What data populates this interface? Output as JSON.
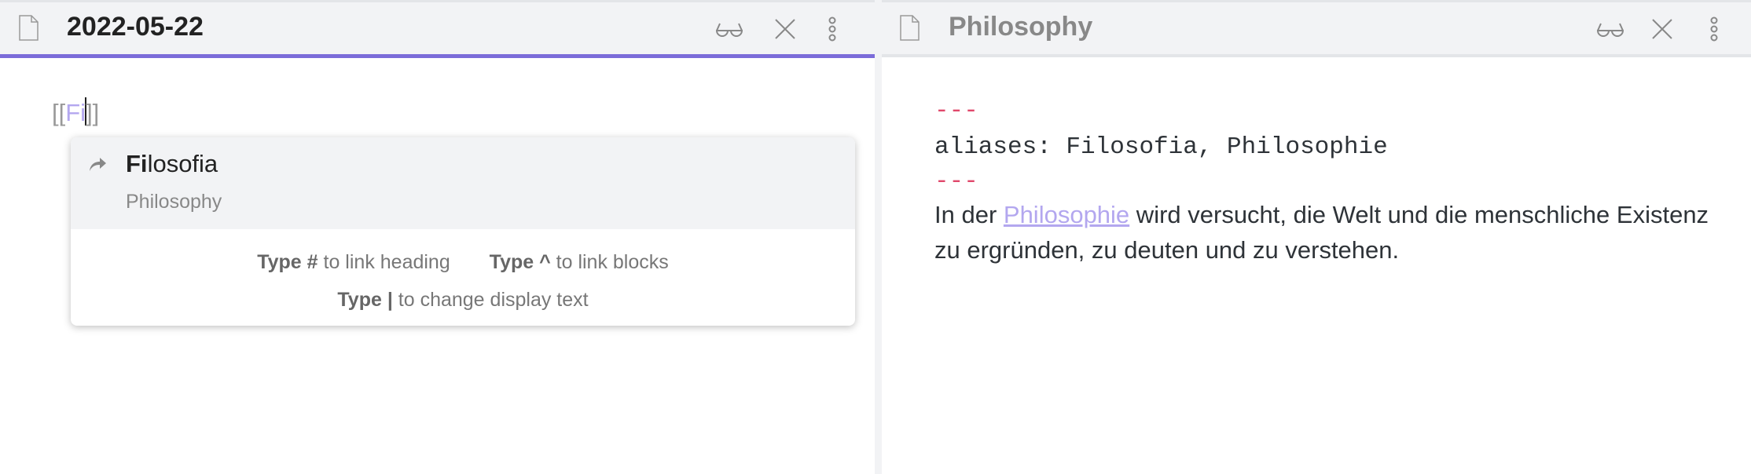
{
  "left_pane": {
    "title": "2022-05-22",
    "editor": {
      "open": "[[",
      "typed": "Fi",
      "close": "]]"
    },
    "suggestion": {
      "match": "Fi",
      "rest": "losofia",
      "subtitle": "Philosophy"
    },
    "instructions": [
      {
        "key": "Type #",
        "text": " to link heading"
      },
      {
        "key": "Type ^",
        "text": " to link blocks"
      },
      {
        "key": "Type |",
        "text": " to change display text"
      }
    ]
  },
  "right_pane": {
    "title": "Philosophy",
    "frontmatter": {
      "delim": "---",
      "line": "aliases: Filosofia, Philosophie"
    },
    "paragraph": {
      "before": "In der ",
      "link": "Philosophie",
      "after": " wird versucht, die Welt und die menschliche Existenz zu ergründen, zu deuten und zu verstehen."
    }
  },
  "colors": {
    "accent": "#7b6cd9",
    "link": "#b3a7ef",
    "frontmatter_delim": "#e0486b"
  }
}
